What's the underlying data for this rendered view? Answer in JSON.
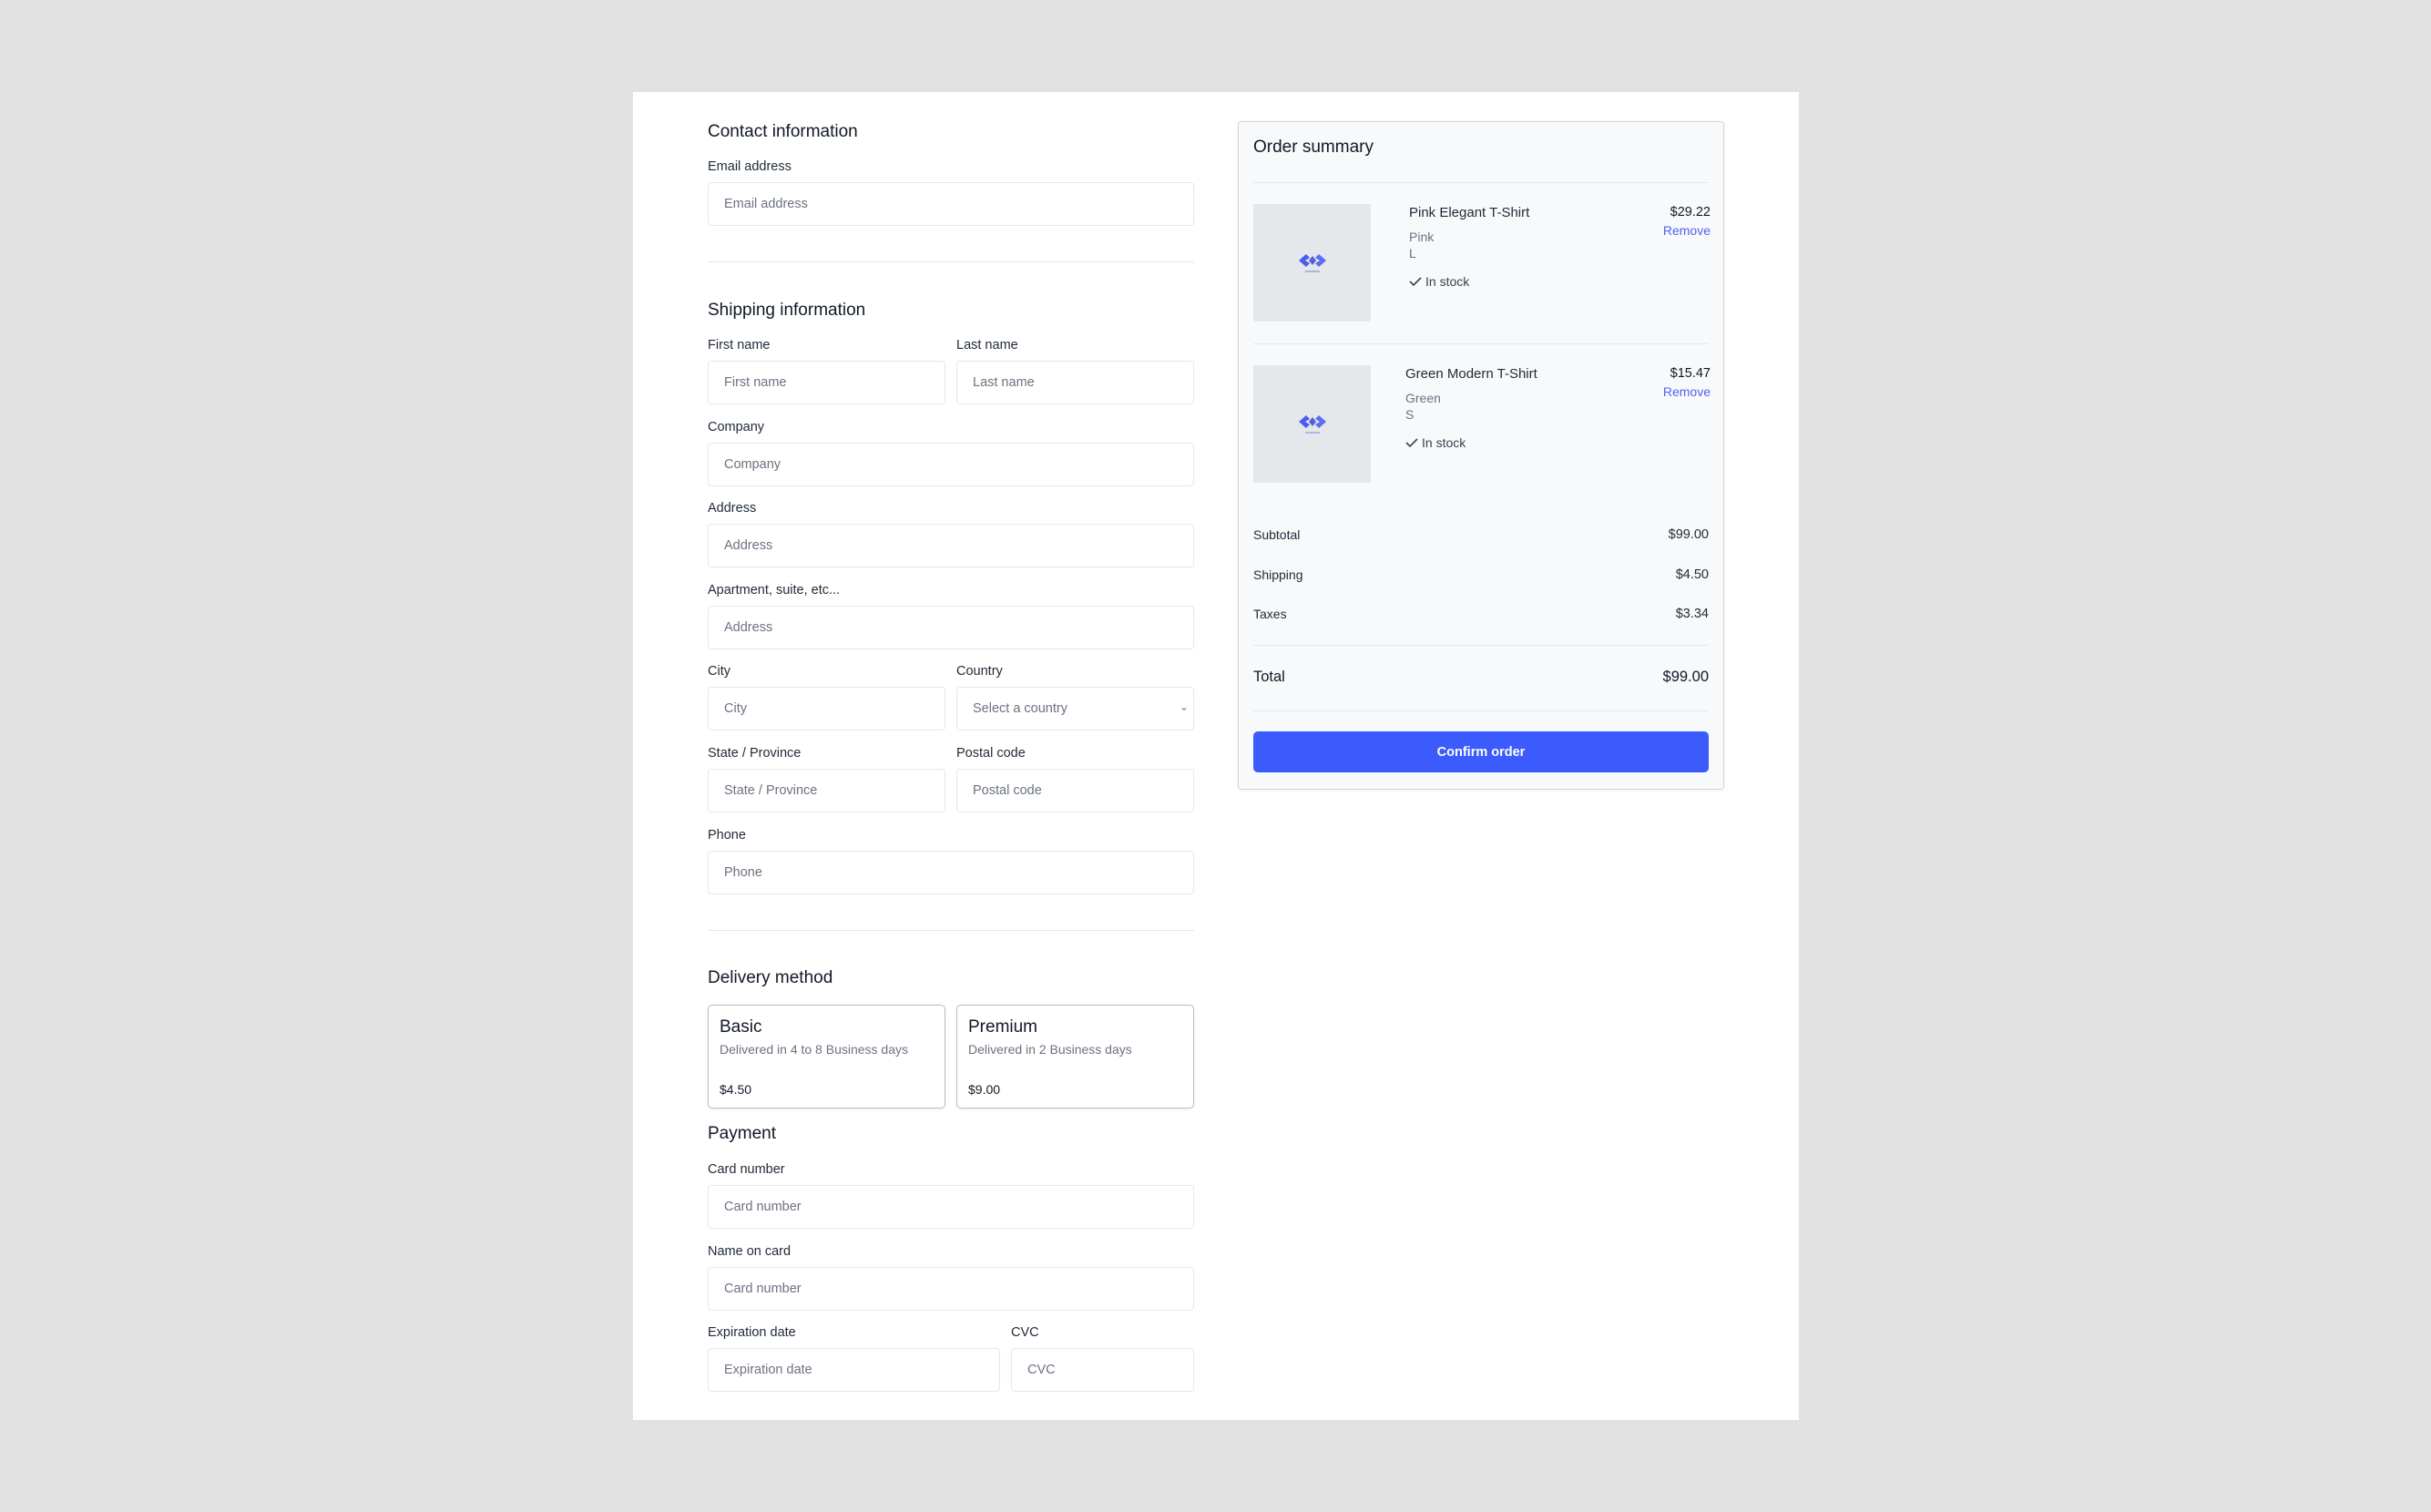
{
  "contact": {
    "title": "Contact information",
    "email_label": "Email address",
    "email_placeholder": "Email address"
  },
  "shipping": {
    "title": "Shipping information",
    "first_name_label": "First name",
    "first_name_placeholder": "First name",
    "last_name_label": "Last name",
    "last_name_placeholder": "Last name",
    "company_label": "Company",
    "company_placeholder": "Company",
    "address_label": "Address",
    "address_placeholder": "Address",
    "apartment_label": "Apartment, suite, etc...",
    "apartment_placeholder": "Address",
    "city_label": "City",
    "city_placeholder": "City",
    "country_label": "Country",
    "country_placeholder": "Select a country",
    "state_label": "State / Province",
    "state_placeholder": "State / Province",
    "postal_label": "Postal code",
    "postal_placeholder": "Postal code",
    "phone_label": "Phone",
    "phone_placeholder": "Phone"
  },
  "delivery": {
    "title": "Delivery method",
    "options": [
      {
        "name": "Basic",
        "desc": "Delivered in 4 to 8 Business days",
        "price": "$4.50"
      },
      {
        "name": "Premium",
        "desc": "Delivered in 2 Business days",
        "price": "$9.00"
      }
    ]
  },
  "payment": {
    "title": "Payment",
    "card_number_label": "Card number",
    "card_number_placeholder": "Card number",
    "name_on_card_label": "Name on card",
    "name_on_card_placeholder": "Card number",
    "expiration_label": "Expiration date",
    "expiration_placeholder": "Expiration date",
    "cvc_label": "CVC",
    "cvc_placeholder": "CVC"
  },
  "summary": {
    "title": "Order summary",
    "items": [
      {
        "name": "Pink Elegant T-Shirt",
        "color": "Pink",
        "size": "L",
        "stock": "In stock",
        "price": "$29.22",
        "remove": "Remove"
      },
      {
        "name": "Green Modern T-Shirt",
        "color": "Green",
        "size": "S",
        "stock": "In stock",
        "price": "$15.47",
        "remove": "Remove"
      }
    ],
    "subtotal_label": "Subtotal",
    "subtotal_value": "$99.00",
    "shipping_label": "Shipping",
    "shipping_value": "$4.50",
    "taxes_label": "Taxes",
    "taxes_value": "$3.34",
    "total_label": "Total",
    "total_value": "$99.00",
    "confirm_label": "Confirm order"
  },
  "colors": {
    "accent": "#3b5bfd",
    "link": "#4f63f3",
    "page_background": "#e2e2e2"
  },
  "icons": {
    "product_thumbnail": "logo-placeholder-icon",
    "stock": "check-icon",
    "select": "chevron-down-icon"
  }
}
